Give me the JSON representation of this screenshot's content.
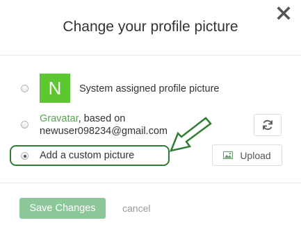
{
  "dialog": {
    "title": "Change your profile picture",
    "close_icon": "close-icon"
  },
  "options": {
    "system": {
      "avatar_letter": "N",
      "label": "System assigned profile picture"
    },
    "gravatar": {
      "link_text": "Gravatar",
      "text_after_link": ", based on",
      "email": "newuser098234@gmail.com",
      "refresh_icon": "refresh-icon"
    },
    "custom": {
      "label": "Add a custom picture",
      "upload_label": "Upload",
      "upload_icon": "image-icon"
    }
  },
  "footer": {
    "save_label": "Save Changes",
    "cancel_label": "cancel"
  },
  "colors": {
    "avatar_bg": "#5cc731",
    "link": "#5aa153",
    "save_button": "#8cc79a",
    "annotation": "#2e7d32"
  }
}
